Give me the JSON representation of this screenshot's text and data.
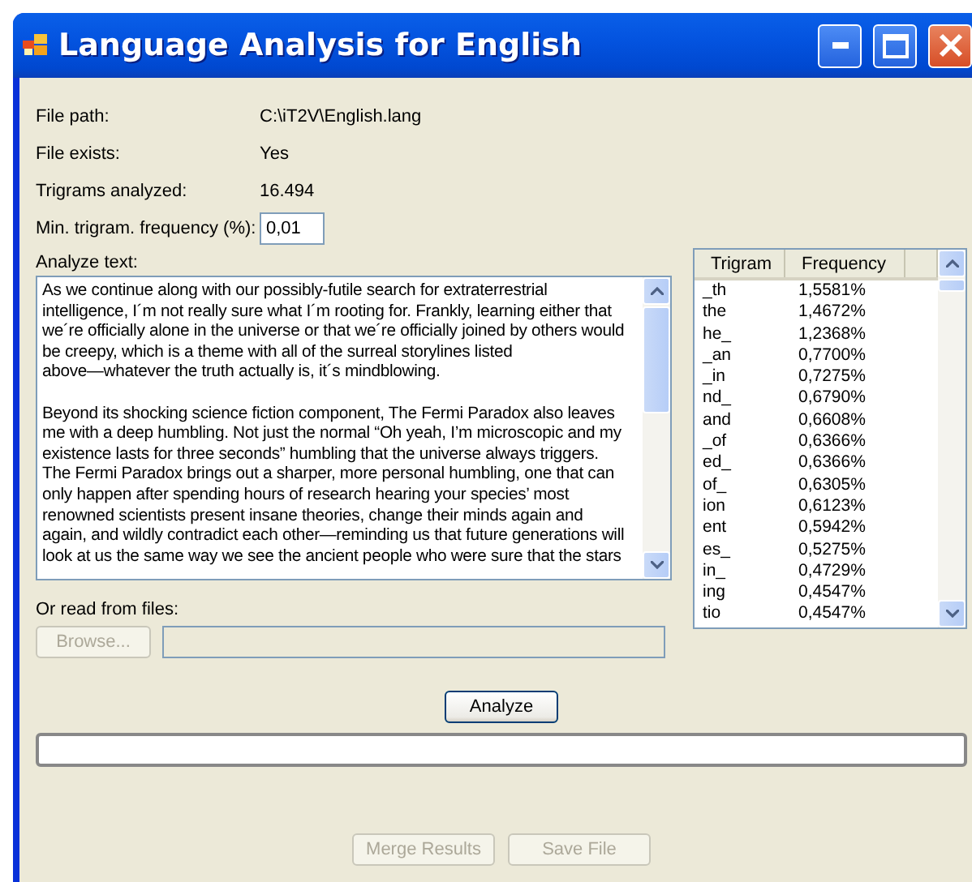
{
  "window": {
    "title": "Language Analysis for English"
  },
  "info": [
    {
      "label": "File path:",
      "value": "C:\\iT2V\\English.lang"
    },
    {
      "label": "File exists:",
      "value": "Yes"
    },
    {
      "label": "Trigrams analyzed:",
      "value": "16.494"
    }
  ],
  "min_frequency": {
    "label": "Min. trigram. frequency (%):",
    "value": "0,01"
  },
  "analyze_text": {
    "label": "Analyze text:",
    "paragraphs": [
      [
        "As we continue along with our possibly-futile search for extraterrestrial",
        "intelligence, I´m not really sure what I´m rooting for. Frankly, learning either that",
        "we´re officially alone in the universe or that we´re officially joined by others would",
        "be creepy, which is a theme with all of the surreal storylines listed",
        "above—whatever the truth actually is, it´s mindblowing."
      ],
      [
        "Beyond its shocking science fiction component, The Fermi Paradox also leaves",
        "me with a deep humbling. Not just the normal “Oh yeah, I’m microscopic and my",
        "existence lasts for three seconds” humbling that the universe always triggers.",
        "The Fermi Paradox brings out a sharper, more personal humbling, one that can",
        "only happen after spending hours of research hearing your species’ most",
        "renowned scientists present insane theories, change their minds again and",
        "again, and wildly contradict each other—reminding us that future generations will",
        "look at us the same way we see the ancient people who were sure that the stars"
      ]
    ]
  },
  "trigram_table": {
    "columns": [
      "Trigram",
      "Frequency"
    ],
    "rows": [
      [
        "_th",
        "1,5581%"
      ],
      [
        "the",
        "1,4672%"
      ],
      [
        "he_",
        "1,2368%"
      ],
      [
        "_an",
        "0,7700%"
      ],
      [
        "_in",
        "0,7275%"
      ],
      [
        "nd_",
        "0,6790%"
      ],
      [
        "and",
        "0,6608%"
      ],
      [
        "_of",
        "0,6366%"
      ],
      [
        "ed_",
        "0,6366%"
      ],
      [
        "of_",
        "0,6305%"
      ],
      [
        "ion",
        "0,6123%"
      ],
      [
        "ent",
        "0,5942%"
      ],
      [
        "es_",
        "0,5275%"
      ],
      [
        "in_",
        "0,4729%"
      ],
      [
        "ing",
        "0,4547%"
      ],
      [
        "tio",
        "0,4547%"
      ]
    ]
  },
  "files": {
    "label": "Or read from files:",
    "browse": {
      "label": "Browse...",
      "disabled": true
    },
    "path_disabled": true
  },
  "analyze_button": {
    "label": "Analyze",
    "disabled": false
  },
  "bottom_buttons": [
    {
      "label": "Merge Results",
      "disabled": true
    },
    {
      "label": "Save File",
      "disabled": true
    }
  ]
}
